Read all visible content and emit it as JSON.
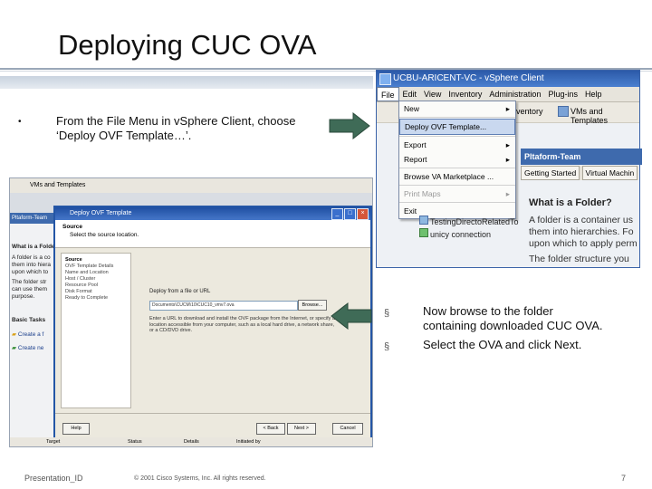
{
  "slide": {
    "title": "Deploying CUC OVA",
    "bullet1_mark": "•",
    "bullet1_line1": "From the File Menu in vSphere Client, choose",
    "bullet1_line2": "‘Deploy OVF Template…’.",
    "bullet2_mark": "§",
    "bullet2_line1": "Now browse to the folder",
    "bullet2_line2": "containing downloaded CUC OVA.",
    "bullet3_mark": "§",
    "bullet3_line1": "Select the OVA and click Next.",
    "footer_left": "Presentation_ID",
    "footer_center": "© 2001 Cisco Systems, Inc. All rights reserved.",
    "page_number": "7"
  },
  "vsphere": {
    "window_title": "UCBU-ARICENT-VC - vSphere Client",
    "menus": [
      "File",
      "Edit",
      "View",
      "Inventory",
      "Administration",
      "Plug-ins",
      "Help"
    ],
    "toolbar_inventory": "ventory",
    "toolbar_vms": "VMs and Templates",
    "file_menu": {
      "new": "New",
      "deploy": "Deploy OVF Template...",
      "export": "Export",
      "report": "Report",
      "browse": "Browse VA Marketplace ...",
      "print": "Print Maps",
      "exit": "Exit"
    },
    "pane_header": "Pltaform-Team",
    "tab_getting_started": "Getting Started",
    "tab_virtual_machines": "Virtual Machin",
    "tree_item1": "TestingDirectoRelatedTo",
    "tree_item2": "unicy connection",
    "folder_heading": "What is a Folder?",
    "folder_text1": "A folder is a container us",
    "folder_text2": "them into hierarchies. Fo",
    "folder_text3": "upon which to apply perm",
    "folder_text4": "The folder structure you"
  },
  "wizard": {
    "host_bar": "VMs and Templates",
    "side_header": "Pltaform-Team",
    "side_heading": "What is a Folde",
    "side_text": [
      "A folder is a co",
      "them into hiera",
      "upon which to",
      "The folder str",
      "can use them",
      "purpose."
    ],
    "basic_tasks": "Basic Tasks",
    "task1": "Create a f",
    "task2": "Create ne",
    "title": "Deploy OVF Template",
    "head_label": "Source",
    "head_sub": "Select the source location.",
    "nav_items": [
      "Source",
      "OVF Template Details",
      "Name and Location",
      "Host / Cluster",
      "Resource Pool",
      "Disk Format",
      "Ready to Complete"
    ],
    "prompt": "Deploy from a file or URL",
    "path_value": "Documents\\CUCM\\10\\CUC10_vmv7.ova",
    "browse_label": "Browse...",
    "desc": "Enter a URL to download and install the OVF package from the Internet, or specify a location accessible from your computer, such as a local hard drive, a network share, or a CD/DVD drive.",
    "help_label": "Help",
    "back_label": "< Back",
    "next_label": "Next >",
    "cancel_label": "Cancel",
    "status_target": "Target",
    "status_status": "Status",
    "status_details": "Details",
    "status_initiated": "Initiated by"
  },
  "colors": {
    "arrow_fill": "#3f6b57",
    "title_bar": "#2c5aa8"
  }
}
